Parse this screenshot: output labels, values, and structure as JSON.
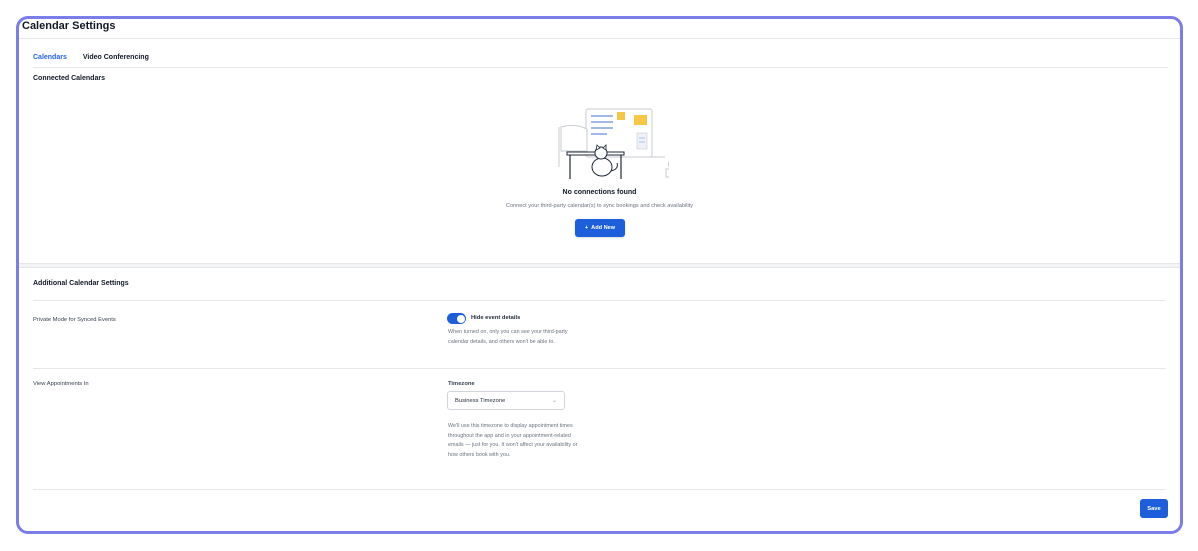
{
  "page": {
    "title": "Calendar Settings"
  },
  "tabs": [
    {
      "label": "Calendars",
      "active": true
    },
    {
      "label": "Video Conferencing",
      "active": false
    }
  ],
  "connected": {
    "title": "Connected Calendars",
    "empty_title": "No connections found",
    "empty_description": "Connect your third-party calendar(s) to sync bookings and check availability",
    "add_icon": "plus-icon",
    "add_label": "Add New"
  },
  "additional": {
    "title": "Additional Calendar Settings",
    "private_mode": {
      "label": "Private Mode for Synced Events",
      "toggle_on": true,
      "toggle_label": "Hide event details",
      "help_lines": [
        "When turned on, only you can see your third-party",
        "calendar details, and others won't be able to."
      ]
    },
    "view_appointments": {
      "label": "View Appointments In",
      "field_label": "Timezone",
      "selected": "Business Timezone",
      "help_lines": [
        "We'll use this timezone to display appointment times",
        "throughout the app and in your appointment-related",
        "emails — just for you. It won't affect your availability or",
        "how others book with you."
      ]
    }
  },
  "footer": {
    "save_label": "Save"
  },
  "colors": {
    "accent": "#1d5fdb",
    "frame": "#7b7de8"
  }
}
